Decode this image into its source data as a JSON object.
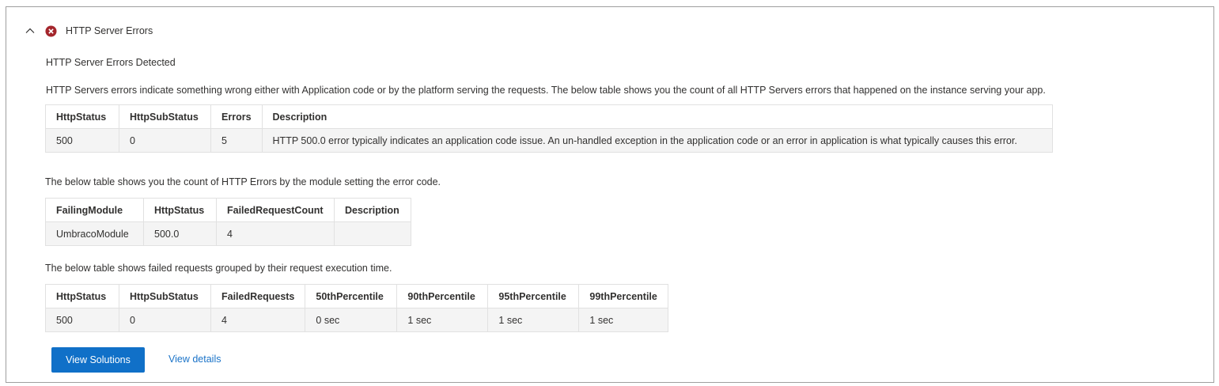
{
  "section": {
    "title": "HTTP Server Errors",
    "chevron_icon": "chevron-up-icon",
    "status_icon": "error-circle-icon",
    "status_color": "#a4262c"
  },
  "detected_title": "HTTP Server Errors Detected",
  "intro_text": "HTTP Servers errors indicate something wrong either with Application code or by the platform serving the requests. The below table shows you the count of all HTTP Servers errors that happened on the instance serving your app.",
  "table1": {
    "headers": [
      "HttpStatus",
      "HttpSubStatus",
      "Errors",
      "Description"
    ],
    "rows": [
      [
        "500",
        "0",
        "5",
        "HTTP 500.0 error typically indicates an application code issue. An un-handled exception in the application code or an error in application is what typically causes this error."
      ]
    ]
  },
  "module_text": "The below table shows you the count of HTTP Errors by the module setting the error code.",
  "table2": {
    "headers": [
      "FailingModule",
      "HttpStatus",
      "FailedRequestCount",
      "Description"
    ],
    "rows": [
      [
        "UmbracoModule",
        "500.0",
        "4",
        ""
      ]
    ]
  },
  "exec_text": "The below table shows failed requests grouped by their request execution time.",
  "table3": {
    "headers": [
      "HttpStatus",
      "HttpSubStatus",
      "FailedRequests",
      "50thPercentile",
      "90thPercentile",
      "95thPercentile",
      "99thPercentile"
    ],
    "rows": [
      [
        "500",
        "0",
        "4",
        "0 sec",
        "1 sec",
        "1 sec",
        "1 sec"
      ]
    ]
  },
  "actions": {
    "view_solutions": "View Solutions",
    "view_details": "View details"
  },
  "colors": {
    "primary_button": "#1070c8",
    "link": "#1a73c8",
    "border": "#9f9f9f"
  }
}
